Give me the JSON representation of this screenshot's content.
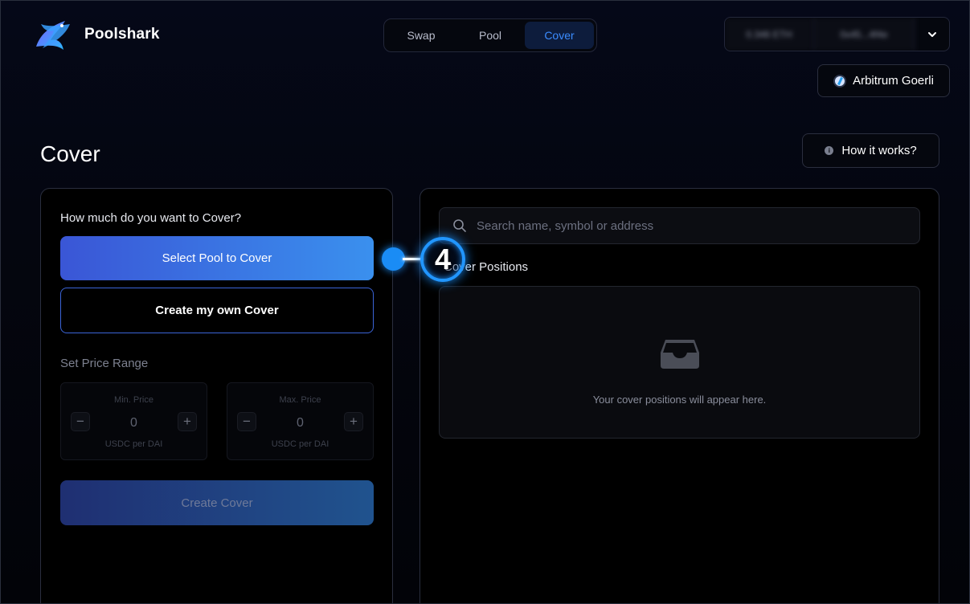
{
  "app": {
    "name": "Poolshark"
  },
  "nav": {
    "tabs": [
      {
        "label": "Swap",
        "active": false
      },
      {
        "label": "Pool",
        "active": false
      },
      {
        "label": "Cover",
        "active": true
      }
    ]
  },
  "wallet": {
    "balance": "0.346 ETH",
    "address": "0x45...4f4e",
    "chevron_icon": "chevron-down-icon"
  },
  "network": {
    "label": "Arbitrum Goerli",
    "icon": "arbitrum-icon"
  },
  "page": {
    "title": "Cover",
    "how_it_works": "How it works?"
  },
  "cover_form": {
    "question": "How much do you want to Cover?",
    "select_pool_label": "Select Pool to Cover",
    "create_own_label": "Create my own Cover",
    "range_label": "Set Price Range",
    "min_price": {
      "caption": "Min. Price",
      "value": "0",
      "unit": "USDC per DAI"
    },
    "max_price": {
      "caption": "Max. Price",
      "value": "0",
      "unit": "USDC per DAI"
    },
    "create_cover_label": "Create Cover"
  },
  "positions": {
    "search_placeholder": "Search name, symbol or address",
    "section_label": "Cover Positions",
    "empty_text": "Your cover positions will appear here."
  },
  "step_marker": {
    "number": "4"
  },
  "colors": {
    "accent": "#3b8cff",
    "primary_gradient_start": "#3a56d6",
    "primary_gradient_end": "#3a90ee",
    "marker": "#1a8cf5"
  }
}
